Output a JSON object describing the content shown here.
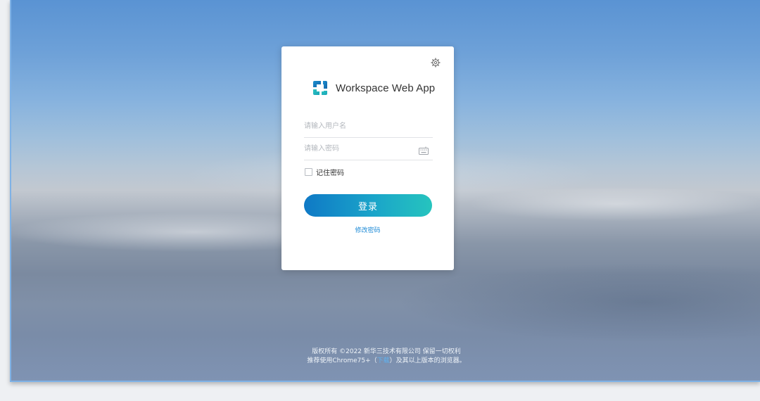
{
  "app": {
    "name": "Workspace Web App",
    "accent_color": "#1aa5c9",
    "logo_icon": "workspace-logo-icon"
  },
  "login_form": {
    "username_placeholder": "请输入用户名",
    "password_placeholder": "请输入密码",
    "remember_label": "记住密码",
    "remember_checked": false,
    "login_button_label": "登录",
    "change_password_label": "修改密码",
    "settings_icon": "gear-icon",
    "keyboard_icon": "keyboard-icon"
  },
  "footer": {
    "copyright": "版权所有 ©2022 新华三技术有限公司 保留一切权利",
    "recommend_prefix": "推荐使用Chrome75+（",
    "download_link": "下载",
    "recommend_suffix": "）及其以上版本的浏览器。"
  }
}
